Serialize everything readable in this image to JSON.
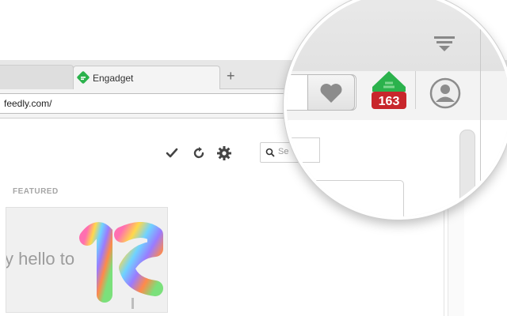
{
  "browser": {
    "active_tab_label": "Engadget",
    "new_tab_symbol": "+",
    "address": "feedly.com/"
  },
  "page": {
    "section_label": "FEATURED",
    "featured_card_text": "y hello to",
    "search_placeholder": "Se"
  },
  "extension": {
    "badge_count": "163",
    "accent_color": "#2bb24c",
    "badge_color": "#c8262b"
  },
  "icons": [
    "feedly-icon",
    "heart-icon",
    "avatar-icon",
    "menu-icon",
    "check-icon",
    "refresh-icon",
    "gear-icon",
    "search-icon"
  ]
}
